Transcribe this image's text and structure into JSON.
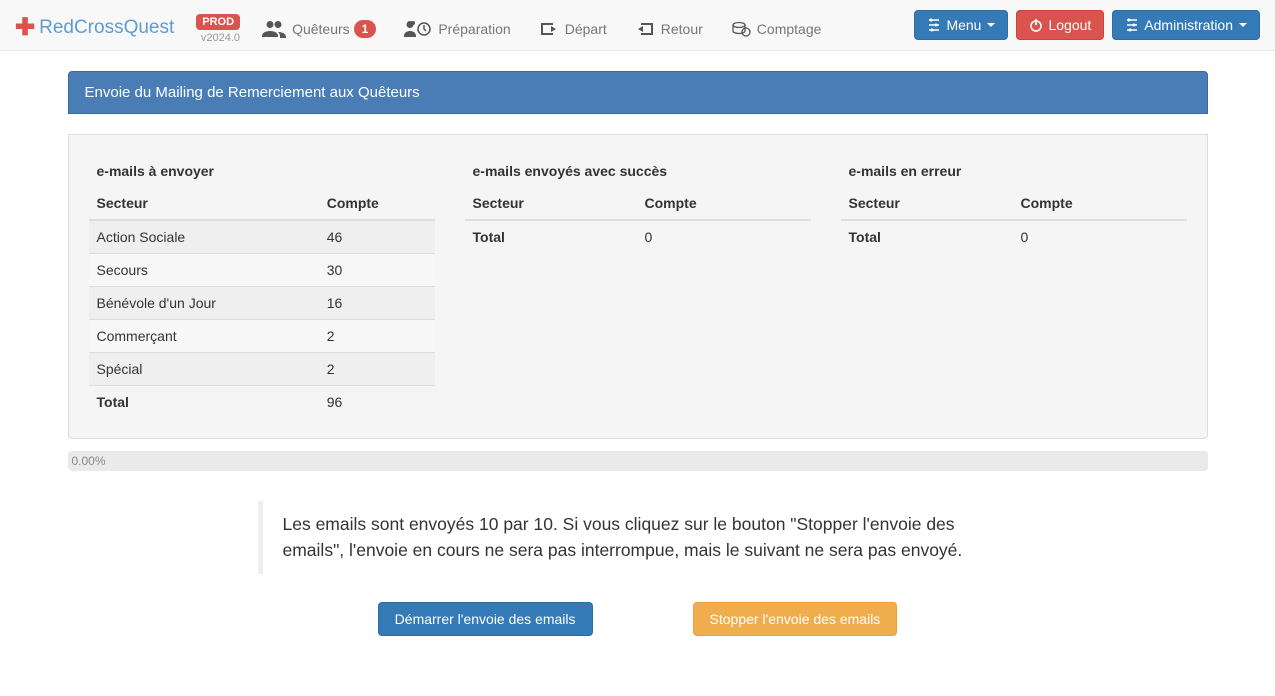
{
  "brand": {
    "name": "RedCrossQuest",
    "env": "PROD",
    "version": "v2024.0"
  },
  "nav": {
    "queteurs": {
      "label": "Quêteurs",
      "badge": "1"
    },
    "preparation": {
      "label": "Préparation"
    },
    "depart": {
      "label": "Départ"
    },
    "retour": {
      "label": "Retour"
    },
    "comptage": {
      "label": "Comptage"
    }
  },
  "topbuttons": {
    "menu": "Menu",
    "logout": "Logout",
    "admin": "Administration"
  },
  "page": {
    "heading": "Envoie du Mailing de Remerciement aux Quêteurs"
  },
  "headers": {
    "secteur": "Secteur",
    "compte": "Compte",
    "total": "Total"
  },
  "toSend": {
    "title": "e-mails à envoyer",
    "rows": [
      {
        "secteur": "Action Sociale",
        "compte": "46"
      },
      {
        "secteur": "Secours",
        "compte": "30"
      },
      {
        "secteur": "Bénévole d'un Jour",
        "compte": "16"
      },
      {
        "secteur": "Commerçant",
        "compte": "2"
      },
      {
        "secteur": "Spécial",
        "compte": "2"
      }
    ],
    "total": "96"
  },
  "sent": {
    "title": "e-mails envoyés avec succès",
    "total": "0"
  },
  "errors": {
    "title": "e-mails en erreur",
    "total": "0"
  },
  "progress": {
    "label": "0.00%"
  },
  "info": {
    "text": "Les emails sont envoyés 10 par 10. Si vous cliquez sur le bouton \"Stopper l'envoie des emails\", l'envoie en cours ne sera pas interrompue, mais le suivant ne sera pas envoyé."
  },
  "actions": {
    "start": "Démarrer l'envoie des emails",
    "stop": "Stopper l'envoie des emails"
  }
}
